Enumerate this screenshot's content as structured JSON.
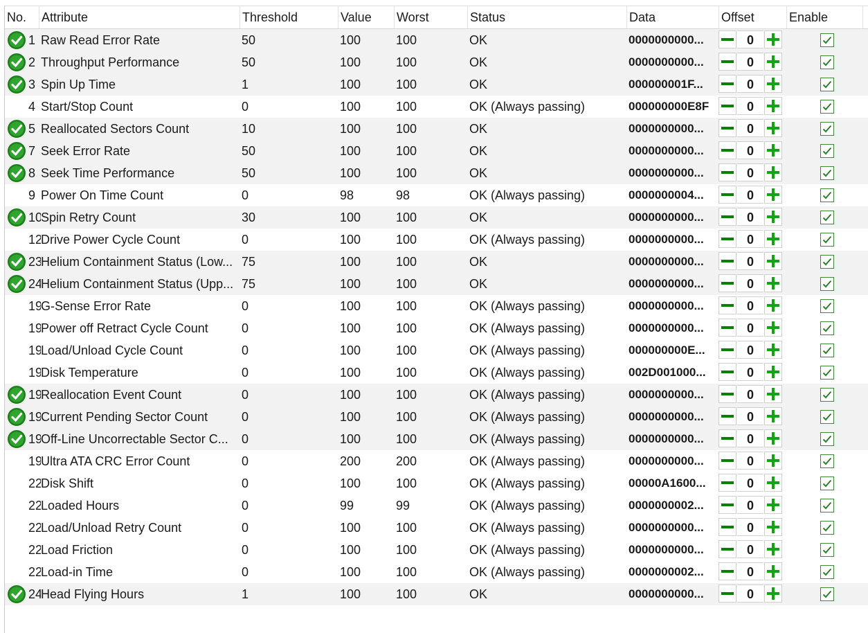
{
  "columns": {
    "no": "No.",
    "attribute": "Attribute",
    "threshold": "Threshold",
    "value": "Value",
    "worst": "Worst",
    "status": "Status",
    "data": "Data",
    "offset": "Offset",
    "enable": "Enable"
  },
  "colors": {
    "ok_icon_green": "#1e7e1e",
    "plus_green": "#13a313",
    "minus_green": "#0b7d0b",
    "row_shade": "#f2f2f2"
  },
  "icons": {
    "status_ok": "check-circle-icon",
    "decrement": "minus-icon",
    "increment": "plus-icon",
    "enabled": "checkbox-checked-icon"
  },
  "rows": [
    {
      "ok": true,
      "no": "1",
      "attribute": "Raw Read Error Rate",
      "threshold": "50",
      "value": "100",
      "worst": "100",
      "status": "OK",
      "data": "0000000000...",
      "offset": "0",
      "enabled": true
    },
    {
      "ok": true,
      "no": "2",
      "attribute": "Throughput Performance",
      "threshold": "50",
      "value": "100",
      "worst": "100",
      "status": "OK",
      "data": "0000000000...",
      "offset": "0",
      "enabled": true
    },
    {
      "ok": true,
      "no": "3",
      "attribute": "Spin Up Time",
      "threshold": "1",
      "value": "100",
      "worst": "100",
      "status": "OK",
      "data": "000000001F...",
      "offset": "0",
      "enabled": true
    },
    {
      "ok": false,
      "no": "4",
      "attribute": "Start/Stop Count",
      "threshold": "0",
      "value": "100",
      "worst": "100",
      "status": "OK (Always passing)",
      "data": "000000000E8F",
      "offset": "0",
      "enabled": true
    },
    {
      "ok": true,
      "no": "5",
      "attribute": "Reallocated Sectors Count",
      "threshold": "10",
      "value": "100",
      "worst": "100",
      "status": "OK",
      "data": "0000000000...",
      "offset": "0",
      "enabled": true
    },
    {
      "ok": true,
      "no": "7",
      "attribute": "Seek Error Rate",
      "threshold": "50",
      "value": "100",
      "worst": "100",
      "status": "OK",
      "data": "0000000000...",
      "offset": "0",
      "enabled": true
    },
    {
      "ok": true,
      "no": "8",
      "attribute": "Seek Time Performance",
      "threshold": "50",
      "value": "100",
      "worst": "100",
      "status": "OK",
      "data": "0000000000...",
      "offset": "0",
      "enabled": true
    },
    {
      "ok": false,
      "no": "9",
      "attribute": "Power On Time Count",
      "threshold": "0",
      "value": "98",
      "worst": "98",
      "status": "OK (Always passing)",
      "data": "0000000004...",
      "offset": "0",
      "enabled": true
    },
    {
      "ok": true,
      "no": "10",
      "attribute": "Spin Retry Count",
      "threshold": "30",
      "value": "100",
      "worst": "100",
      "status": "OK",
      "data": "0000000000...",
      "offset": "0",
      "enabled": true
    },
    {
      "ok": false,
      "no": "12",
      "attribute": "Drive Power Cycle Count",
      "threshold": "0",
      "value": "100",
      "worst": "100",
      "status": "OK (Always passing)",
      "data": "0000000000...",
      "offset": "0",
      "enabled": true
    },
    {
      "ok": true,
      "no": "23",
      "attribute": "Helium Containment Status (Low...",
      "threshold": "75",
      "value": "100",
      "worst": "100",
      "status": "OK",
      "data": "0000000000...",
      "offset": "0",
      "enabled": true
    },
    {
      "ok": true,
      "no": "24",
      "attribute": "Helium Containment Status (Upp...",
      "threshold": "75",
      "value": "100",
      "worst": "100",
      "status": "OK",
      "data": "0000000000...",
      "offset": "0",
      "enabled": true
    },
    {
      "ok": false,
      "no": "19",
      "attribute": "G-Sense Error Rate",
      "threshold": "0",
      "value": "100",
      "worst": "100",
      "status": "OK (Always passing)",
      "data": "0000000000...",
      "offset": "0",
      "enabled": true
    },
    {
      "ok": false,
      "no": "19",
      "attribute": "Power off Retract Cycle Count",
      "threshold": "0",
      "value": "100",
      "worst": "100",
      "status": "OK (Always passing)",
      "data": "0000000000...",
      "offset": "0",
      "enabled": true
    },
    {
      "ok": false,
      "no": "19",
      "attribute": "Load/Unload Cycle Count",
      "threshold": "0",
      "value": "100",
      "worst": "100",
      "status": "OK (Always passing)",
      "data": "000000000E...",
      "offset": "0",
      "enabled": true
    },
    {
      "ok": false,
      "no": "19",
      "attribute": "Disk Temperature",
      "threshold": "0",
      "value": "100",
      "worst": "100",
      "status": "OK (Always passing)",
      "data": "002D001000...",
      "offset": "0",
      "enabled": true
    },
    {
      "ok": true,
      "no": "19",
      "attribute": "Reallocation Event Count",
      "threshold": "0",
      "value": "100",
      "worst": "100",
      "status": "OK (Always passing)",
      "data": "0000000000...",
      "offset": "0",
      "enabled": true
    },
    {
      "ok": true,
      "no": "19",
      "attribute": "Current Pending Sector Count",
      "threshold": "0",
      "value": "100",
      "worst": "100",
      "status": "OK (Always passing)",
      "data": "0000000000...",
      "offset": "0",
      "enabled": true
    },
    {
      "ok": true,
      "no": "19",
      "attribute": "Off-Line Uncorrectable Sector C...",
      "threshold": "0",
      "value": "100",
      "worst": "100",
      "status": "OK (Always passing)",
      "data": "0000000000...",
      "offset": "0",
      "enabled": true
    },
    {
      "ok": false,
      "no": "19",
      "attribute": "Ultra ATA CRC Error Count",
      "threshold": "0",
      "value": "200",
      "worst": "200",
      "status": "OK (Always passing)",
      "data": "0000000000...",
      "offset": "0",
      "enabled": true
    },
    {
      "ok": false,
      "no": "22",
      "attribute": "Disk Shift",
      "threshold": "0",
      "value": "100",
      "worst": "100",
      "status": "OK (Always passing)",
      "data": "00000A1600...",
      "offset": "0",
      "enabled": true
    },
    {
      "ok": false,
      "no": "22",
      "attribute": "Loaded Hours",
      "threshold": "0",
      "value": "99",
      "worst": "99",
      "status": "OK (Always passing)",
      "data": "0000000002...",
      "offset": "0",
      "enabled": true
    },
    {
      "ok": false,
      "no": "22",
      "attribute": "Load/Unload Retry Count",
      "threshold": "0",
      "value": "100",
      "worst": "100",
      "status": "OK (Always passing)",
      "data": "0000000000...",
      "offset": "0",
      "enabled": true
    },
    {
      "ok": false,
      "no": "22",
      "attribute": "Load Friction",
      "threshold": "0",
      "value": "100",
      "worst": "100",
      "status": "OK (Always passing)",
      "data": "0000000000...",
      "offset": "0",
      "enabled": true
    },
    {
      "ok": false,
      "no": "22",
      "attribute": "Load-in Time",
      "threshold": "0",
      "value": "100",
      "worst": "100",
      "status": "OK (Always passing)",
      "data": "0000000002...",
      "offset": "0",
      "enabled": true
    },
    {
      "ok": true,
      "no": "24",
      "attribute": "Head Flying Hours",
      "threshold": "1",
      "value": "100",
      "worst": "100",
      "status": "OK",
      "data": "0000000000...",
      "offset": "0",
      "enabled": true
    }
  ]
}
